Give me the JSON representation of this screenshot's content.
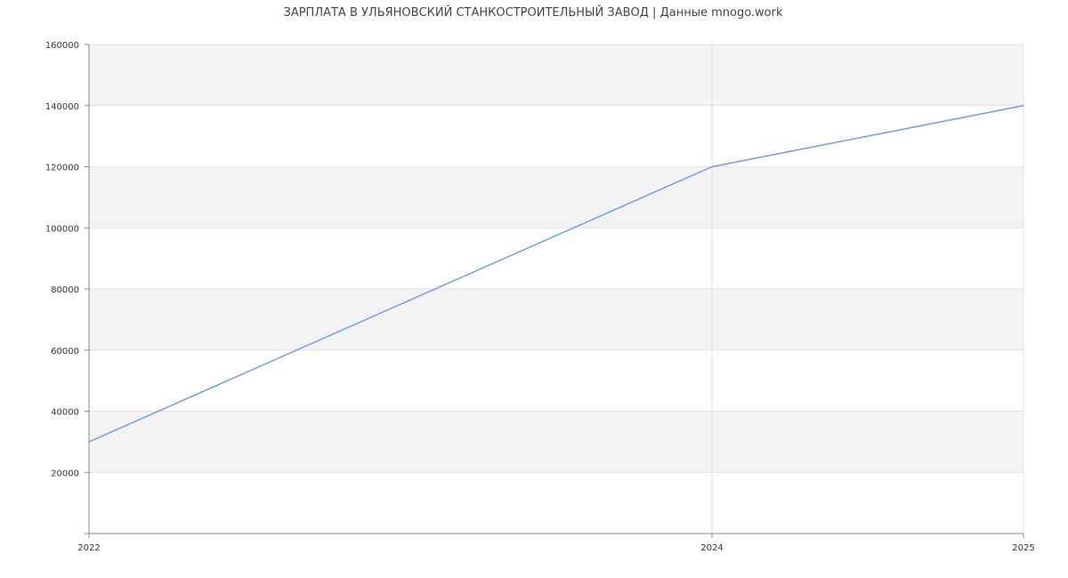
{
  "chart_data": {
    "type": "line",
    "title": "ЗАРПЛАТА В УЛЬЯНОВСКИЙ СТАНКОСТРОИТЕЛЬНЫЙ ЗАВОД | Данные mnogo.work",
    "xlabel": "",
    "ylabel": "",
    "x": [
      2022,
      2024,
      2025
    ],
    "series": [
      {
        "values": [
          30000,
          120000,
          140000
        ]
      }
    ],
    "x_ticks": [
      "2022",
      "2024",
      "2025"
    ],
    "y_ticks": [
      "20000",
      "40000",
      "60000",
      "80000",
      "100000",
      "120000",
      "140000",
      "160000"
    ],
    "xlim": [
      2022,
      2025
    ],
    "ylim": [
      0,
      160000
    ],
    "grid": true,
    "legend": "none",
    "colors": {
      "line": "#6d9eeb",
      "band": "#f3f3f3",
      "grid": "#e2e2e2",
      "axis": "#888888",
      "text": "#333333"
    }
  }
}
